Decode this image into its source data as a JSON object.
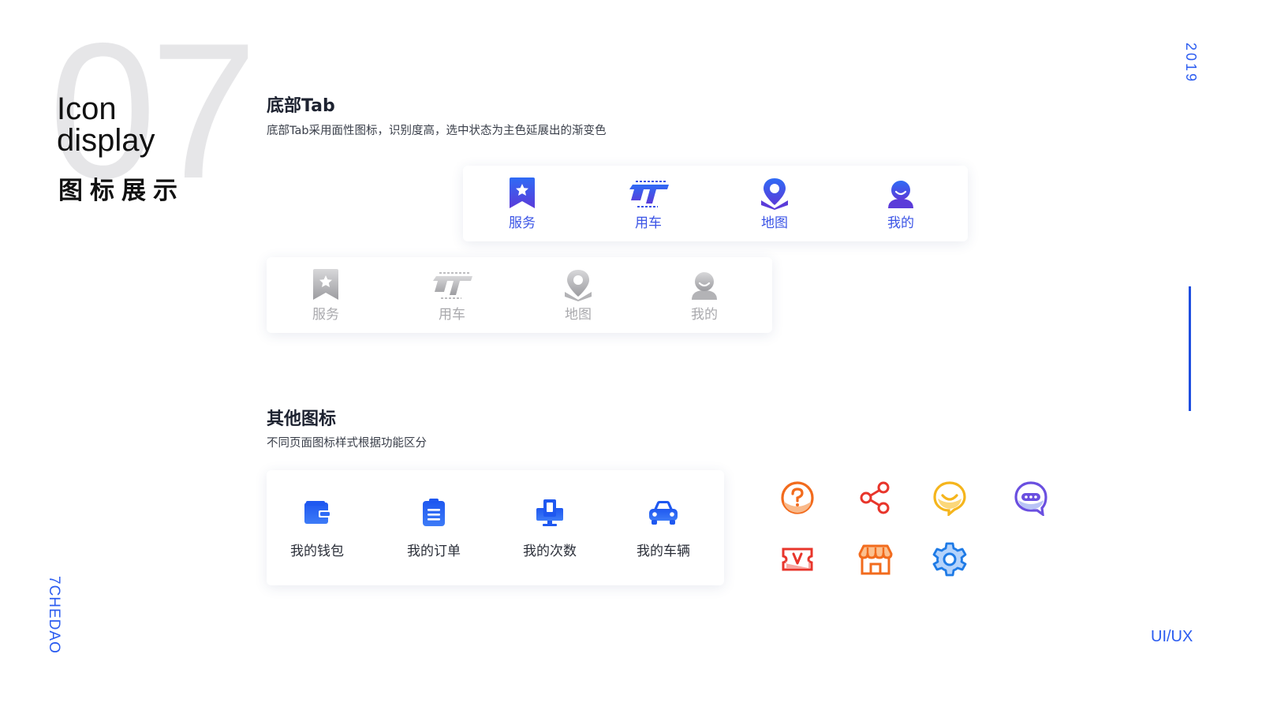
{
  "header": {
    "big_number": "07",
    "title_en_line1": "Icon",
    "title_en_line2": "display",
    "title_cn": "图标展示"
  },
  "side": {
    "year": "2019",
    "brand": "7CHEDAO",
    "footer_tag": "UI/UX"
  },
  "section_tab": {
    "title": "底部Tab",
    "description": "底部Tab采用面性图标，识别度高，选中状态为主色延展出的渐变色",
    "active_items": [
      {
        "label": "服务",
        "icon": "bookmark-star-icon"
      },
      {
        "label": "用车",
        "icon": "car-logo-icon"
      },
      {
        "label": "地图",
        "icon": "map-pin-icon"
      },
      {
        "label": "我的",
        "icon": "user-icon"
      }
    ],
    "inactive_items": [
      {
        "label": "服务",
        "icon": "bookmark-star-icon"
      },
      {
        "label": "用车",
        "icon": "car-logo-icon"
      },
      {
        "label": "地图",
        "icon": "map-pin-icon"
      },
      {
        "label": "我的",
        "icon": "user-icon"
      }
    ]
  },
  "section_other": {
    "title": "其他图标",
    "description": "不同页面图标样式根据功能区分",
    "items": [
      {
        "label": "我的钱包",
        "icon": "wallet-icon"
      },
      {
        "label": "我的订单",
        "icon": "order-clipboard-icon"
      },
      {
        "label": "我的次数",
        "icon": "count-monitor-icon"
      },
      {
        "label": "我的车辆",
        "icon": "vehicle-icon"
      }
    ],
    "misc_icons": [
      "question-icon",
      "share-icon",
      "smile-bubble-icon",
      "chat-bubble-icon",
      "voucher-icon",
      "store-icon",
      "gear-icon"
    ]
  },
  "colors": {
    "accent_blue": "#2a5bf0",
    "gradient_start": "#5b3bd9",
    "gradient_end": "#2f6bf5",
    "inactive_gray": "#a9a9ad",
    "orange": "#f26b1d",
    "red": "#e8352b",
    "yellow": "#f5b51c",
    "purple": "#6a4fe0"
  }
}
